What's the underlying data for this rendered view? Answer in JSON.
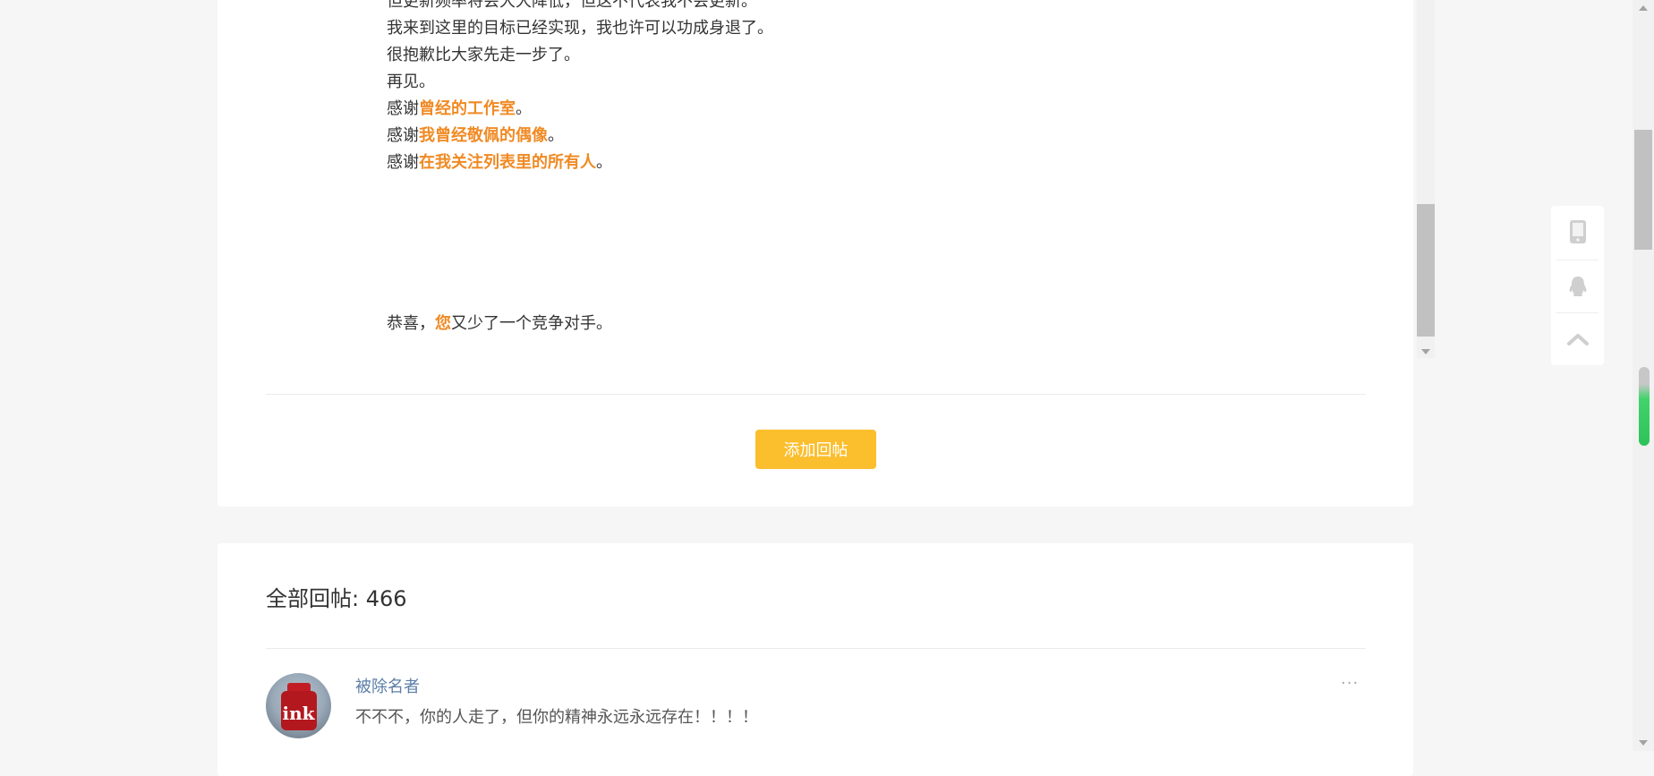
{
  "post": {
    "lines": [
      [
        {
          "t": "但更新频率将会大大降低，但这不代表我不会更新。"
        }
      ],
      [
        {
          "t": "我来到这里的目标已经实现，我也许可以功成身退了。"
        }
      ],
      [
        {
          "t": "很抱歉比大家先走一步了。"
        }
      ],
      [
        {
          "t": "再见。"
        }
      ],
      [
        {
          "t": "感谢"
        },
        {
          "t": "曾经的工作室",
          "hl": true
        },
        {
          "t": "。"
        }
      ],
      [
        {
          "t": "感谢"
        },
        {
          "t": "我曾经敬佩的偶像",
          "hl": true
        },
        {
          "t": "。"
        }
      ],
      [
        {
          "t": "感谢"
        },
        {
          "t": "在我关注列表里的所有人",
          "hl": true
        },
        {
          "t": "。"
        }
      ],
      [
        {
          "t": "恭喜，"
        },
        {
          "t": "您",
          "hl": true
        },
        {
          "t": "又少了一个竞争对手。"
        }
      ]
    ],
    "highlight_color": "#f08a24"
  },
  "actions": {
    "add_reply_label": "添加回帖",
    "button_color": "#fbbe2c"
  },
  "replies": {
    "title": "全部回帖: 466",
    "items": [
      {
        "avatar_text": "ink",
        "author": "被除名者",
        "text": "不不不，你的人走了，但你的精神永远永远存在！！！！",
        "more_label": "···"
      }
    ]
  },
  "side_toolbar": {
    "icons": [
      "mobile-icon",
      "qq-icon",
      "back-to-top-icon"
    ]
  }
}
